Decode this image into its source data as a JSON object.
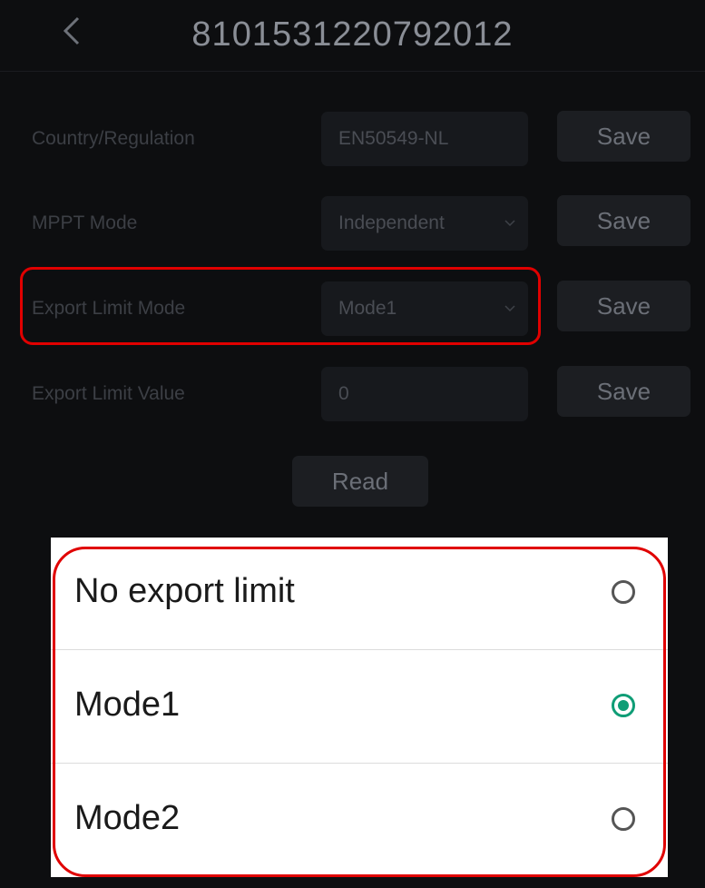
{
  "header": {
    "title": "8101531220792012",
    "back_icon": "chevron-left-icon"
  },
  "settings": {
    "rows": [
      {
        "label": "Country/Regulation",
        "value": "EN50549-NL",
        "has_dropdown": false,
        "save_label": "Save"
      },
      {
        "label": "MPPT Mode",
        "value": "Independent",
        "has_dropdown": true,
        "save_label": "Save"
      },
      {
        "label": "Export Limit Mode",
        "value": "Mode1",
        "has_dropdown": true,
        "save_label": "Save"
      },
      {
        "label": "Export Limit Value",
        "value": "0",
        "has_dropdown": false,
        "save_label": "Save"
      }
    ],
    "read_label": "Read"
  },
  "dialog": {
    "options": [
      {
        "label": "No export limit",
        "selected": false
      },
      {
        "label": "Mode1",
        "selected": true
      },
      {
        "label": "Mode2",
        "selected": false
      }
    ]
  },
  "colors": {
    "background": "#0d0e10",
    "accent": "#0f9d76",
    "highlight": "#e00000"
  }
}
